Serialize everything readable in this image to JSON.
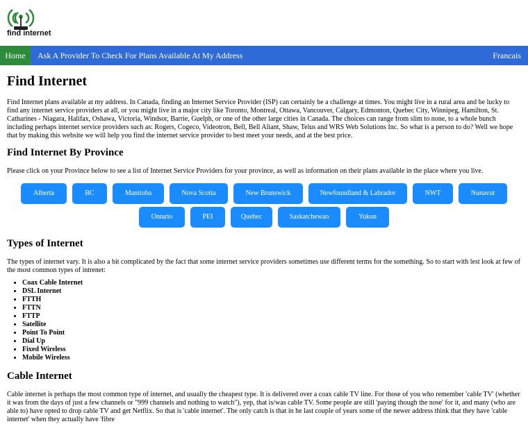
{
  "logo": {
    "text": "find internet",
    "icon": "wifi-antenna-icon",
    "accent": "#2e8b3c"
  },
  "nav": {
    "home": "Home",
    "ask": "Ask A Provider To Check For Plans Available At My Address",
    "francais": "Francais",
    "bar_color": "#2f6bd6"
  },
  "title": "Find Internet",
  "intro": "Find Internet plans available at my address. In Canada, finding an Internet Service Provider (ISP) can certainly be a challenge at times. You might live in a rural area and be lucky to find any internet service providers at all, or you might live in a major city like Toronto, Montreal, Ottawa, Vancouver, Calgary, Edmonton, Quebec City, Winnipeg, Hamilton, St. Catharines - Niagara, Halifax, Oshawa, Victoria, Windsor, Barrie, Guelph, or one of the other large cities in Canada. The choices can range from slim to none, to a whole bunch including perhaps internet service providers such as: Rogers, Cogeco, Videotron, Bell, Bell Aliant, Shaw, Telus and WRS Web Solutions Inc. So what is a person to do? Well we hope that by making this website we will help you find the internet service provider to best meet your needs, and at the best price.",
  "province_heading": "Find Internet By Province",
  "province_intro": "Please click on your Province below to see a list of Internet Service Providers for your province, as well as information on their plans available in the place where you live.",
  "provinces_row1": [
    "Alberta",
    "BC",
    "Manitoba",
    "Nova Scotia",
    "New Brunswick",
    "Newfoundland & Labrador",
    "NWT",
    "Nunavut"
  ],
  "provinces_row2": [
    "Ontario",
    "PEI",
    "Quebec",
    "Saskatchewan",
    "Yukon"
  ],
  "types_heading": "Types of Internet",
  "types_intro": "The types of internet vary. It is also a bit complicated by the fact that some internet service providers sometimes use different terms for the something. So to start with lest look at few of the most common types of intrenet:",
  "types": [
    "Coax Cable Internet",
    "DSL Internet",
    "FTTH",
    "FTTN",
    "FTTP",
    "Satellite",
    "Point To Point",
    "Dial Up",
    "Fixed Wireless",
    "Mobile Wireless"
  ],
  "cable_heading": "Cable Internet",
  "cable_text": "Cable internet is perhaps the most common type of internet, and usually the cheapest type. It is delivered over a coax cable TV line. For those of you who remember 'cable TV' (whether it was from the days of just a few channels or \"999 channels and nothing to watch\"), yep, that is/was cable TV. Some people are still 'paying though the nose' for it, and many (who are able to) have opted to drop cable TV and get Netflix. So that is 'cable internet'. The only catch is that in he last couple of years some of the newer address think that they have 'cable internet' when they actually have 'fibre"
}
